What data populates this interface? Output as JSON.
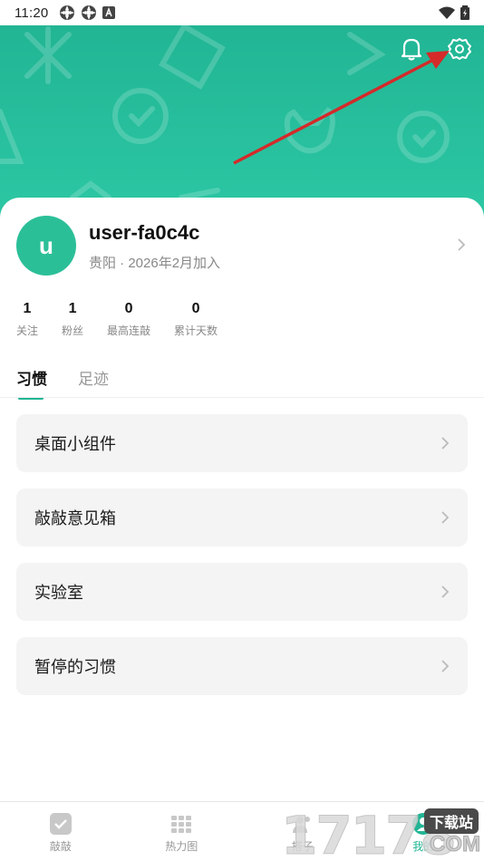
{
  "status_bar": {
    "time": "11:20"
  },
  "profile": {
    "avatar_letter": "u",
    "username": "user-fa0c4c",
    "subinfo": "贵阳 · 2026年2月加入"
  },
  "stats": [
    {
      "value": "1",
      "label": "关注"
    },
    {
      "value": "1",
      "label": "粉丝"
    },
    {
      "value": "0",
      "label": "最高连敲"
    },
    {
      "value": "0",
      "label": "累计天数"
    }
  ],
  "tabs": [
    {
      "label": "习惯",
      "active": true
    },
    {
      "label": "足迹",
      "active": false
    }
  ],
  "menu": [
    {
      "label": "桌面小组件"
    },
    {
      "label": "敲敲意见箱"
    },
    {
      "label": "实验室"
    },
    {
      "label": "暂停的习惯"
    }
  ],
  "bottom_nav": [
    {
      "label": "敲敲",
      "icon": "check-square-icon"
    },
    {
      "label": "热力图",
      "icon": "grid-icon"
    },
    {
      "label": "搭子",
      "icon": "people-icon"
    },
    {
      "label": "我的",
      "icon": "user-icon"
    }
  ],
  "watermark": {
    "digits": "17178",
    "tag": "下载站",
    "domain": "COM"
  },
  "colors": {
    "accent": "#21b594",
    "header_top": "#21b594",
    "header_bottom": "#2cc7a4",
    "arrow": "#d42a2a"
  }
}
